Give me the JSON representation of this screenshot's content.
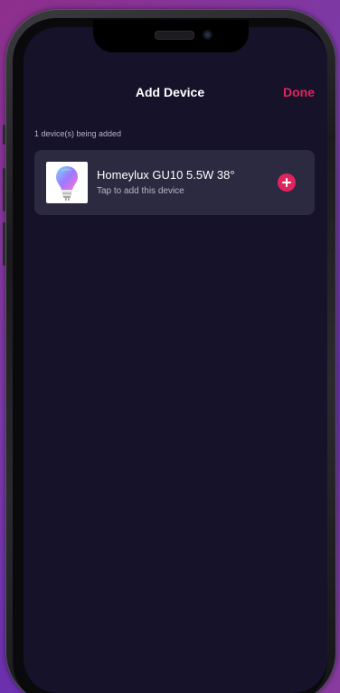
{
  "header": {
    "title": "Add Device",
    "done_label": "Done"
  },
  "status": {
    "text": "1 device(s) being added"
  },
  "devices": [
    {
      "name": "Homeylux GU10 5.5W 38°",
      "subtitle": "Tap to add this device",
      "icon": "bulb-icon"
    }
  ],
  "colors": {
    "accent": "#e0245e",
    "screen_background": "#15122a",
    "card_background": "#2c2a40",
    "text_primary": "#ffffff",
    "text_secondary": "#b9b6c8"
  }
}
